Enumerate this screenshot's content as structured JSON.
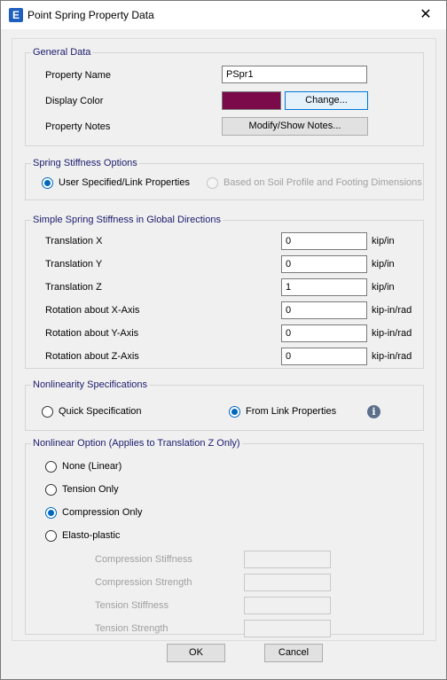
{
  "window": {
    "title": "Point Spring Property Data",
    "app_icon_letter": "E",
    "close_glyph": "✕"
  },
  "general": {
    "title": "General Data",
    "property_name_label": "Property Name",
    "property_name_value": "PSpr1",
    "display_color_label": "Display Color",
    "display_color_value": "#7a0a4a",
    "change_button": "Change...",
    "property_notes_label": "Property Notes",
    "notes_button": "Modify/Show Notes..."
  },
  "stiffness_options": {
    "title": "Spring Stiffness Options",
    "option_user": "User Specified/Link Properties",
    "option_soil": "Based on Soil Profile and Footing Dimensions",
    "selected": "user"
  },
  "global": {
    "title": "Simple Spring Stiffness in Global Directions",
    "rows": [
      {
        "label": "Translation  X",
        "value": "0",
        "unit": "kip/in"
      },
      {
        "label": "Translation  Y",
        "value": "0",
        "unit": "kip/in"
      },
      {
        "label": "Translation  Z",
        "value": "1",
        "unit": "kip/in"
      },
      {
        "label": "Rotation about  X-Axis",
        "value": "0",
        "unit": "kip-in/rad"
      },
      {
        "label": "Rotation about  Y-Axis",
        "value": "0",
        "unit": "kip-in/rad"
      },
      {
        "label": "Rotation about  Z-Axis",
        "value": "0",
        "unit": "kip-in/rad"
      }
    ]
  },
  "nonlinearity": {
    "title": "Nonlinearity Specifications",
    "option_quick": "Quick Specification",
    "option_link": "From Link Properties",
    "selected": "link",
    "info_glyph": "i"
  },
  "nonlinear_option": {
    "title": "Nonlinear Option  (Applies to Translation Z Only)",
    "options": [
      "None (Linear)",
      "Tension Only",
      "Compression Only",
      "Elasto-plastic"
    ],
    "selected_index": 2,
    "params": [
      "Compression Stiffness",
      "Compression Strength",
      "Tension Stiffness",
      "Tension Strength"
    ]
  },
  "footer": {
    "ok": "OK",
    "cancel": "Cancel"
  }
}
